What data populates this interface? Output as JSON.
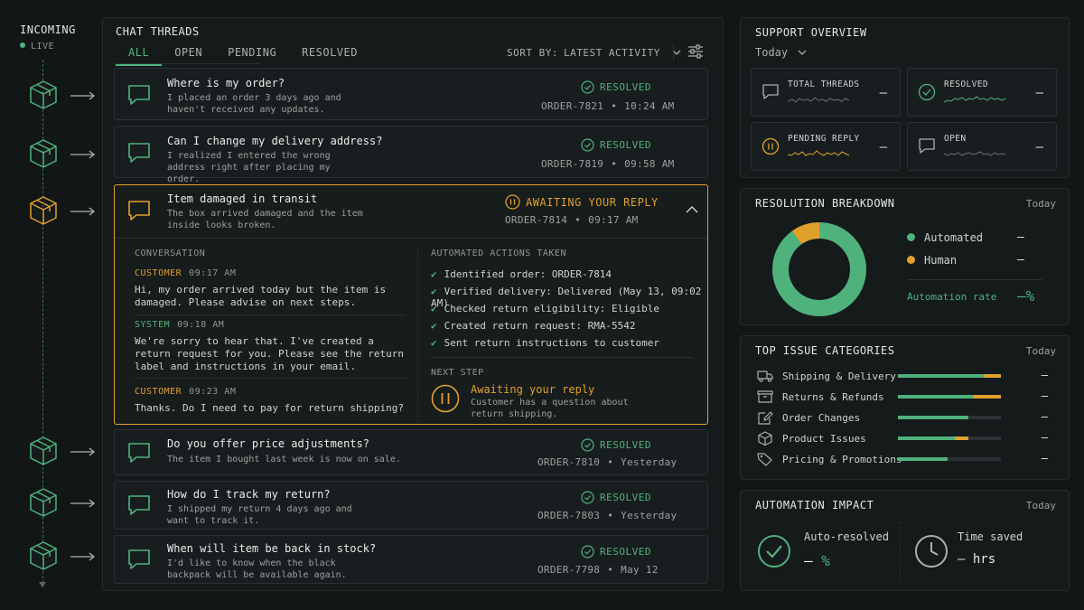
{
  "rail": {
    "title": "INCOMING",
    "live": "LIVE"
  },
  "threads": {
    "title": "CHAT THREADS",
    "tabs": [
      "ALL",
      "OPEN",
      "PENDING",
      "RESOLVED"
    ],
    "sort_label": "SORT BY:",
    "sort_value": "LATEST ACTIVITY",
    "items": [
      {
        "title": "Where is my order?",
        "desc": "I placed an order 3 days ago and haven't received any updates.",
        "status": "RESOLVED",
        "order": "ORDER-7821",
        "time": "10:24 AM"
      },
      {
        "title": "Can I change my delivery address?",
        "desc": "I realized I entered the wrong address right after placing my order.",
        "status": "RESOLVED",
        "order": "ORDER-7819",
        "time": "09:58 AM"
      },
      {
        "title": "Item damaged in transit",
        "desc": "The box arrived damaged and the item inside looks broken.",
        "status": "AWAITING YOUR REPLY",
        "order": "ORDER-7814",
        "time": "09:17 AM"
      },
      {
        "title": "Do you offer price adjustments?",
        "desc": "The item I bought last week is now on sale.",
        "status": "RESOLVED",
        "order": "ORDER-7810",
        "time": "Yesterday"
      },
      {
        "title": "How do I track my return?",
        "desc": "I shipped my return 4 days ago and want to track it.",
        "status": "RESOLVED",
        "order": "ORDER-7803",
        "time": "Yesterday"
      },
      {
        "title": "When will item be back in stock?",
        "desc": "I'd like to know when the black backpack will be available again.",
        "status": "RESOLVED",
        "order": "ORDER-7798",
        "time": "May 12"
      }
    ],
    "expanded": {
      "conversation_label": "CONVERSATION",
      "messages": [
        {
          "who": "CUSTOMER",
          "time": "09:17 AM",
          "text": "Hi, my order arrived today but the item is damaged. Please advise on next steps."
        },
        {
          "who": "SYSTEM",
          "time": "09:18 AM",
          "text": "We're sorry to hear that. I've created a return request for you. Please see the return label and instructions in your email."
        },
        {
          "who": "CUSTOMER",
          "time": "09:23 AM",
          "text": "Thanks. Do I need to pay for return shipping?"
        }
      ],
      "actions_label": "AUTOMATED ACTIONS TAKEN",
      "actions": [
        "Identified order: ORDER-7814",
        "Verified delivery: Delivered (May 13, 09:02 AM)",
        "Checked return eligibility: Eligible",
        "Created return request: RMA-5542",
        "Sent return instructions to customer"
      ],
      "next_step_label": "NEXT STEP",
      "next_step_title": "Awaiting your reply",
      "next_step_desc": "Customer has a question about return shipping."
    }
  },
  "overview": {
    "title": "SUPPORT OVERVIEW",
    "period": "Today",
    "stats": [
      {
        "label": "TOTAL THREADS",
        "value": "—",
        "icon": "chat-icon"
      },
      {
        "label": "RESOLVED",
        "value": "—",
        "icon": "check-circle-icon"
      },
      {
        "label": "PENDING REPLY",
        "value": "—",
        "icon": "pause-circle-icon"
      },
      {
        "label": "OPEN",
        "value": "—",
        "icon": "chat-icon"
      }
    ]
  },
  "breakdown": {
    "title": "RESOLUTION BREAKDOWN",
    "period": "Today",
    "legend": [
      {
        "label": "Automated",
        "value": "—",
        "color": "#4fb27d"
      },
      {
        "label": "Human",
        "value": "—",
        "color": "#e0a12c"
      }
    ],
    "rate_label": "Automation rate",
    "rate_value": "—%",
    "automated_fraction": 0.9
  },
  "issues": {
    "title": "TOP ISSUE CATEGORIES",
    "period": "Today",
    "items": [
      {
        "label": "Shipping & Delivery",
        "value": "—",
        "green": 0.83,
        "amber": 0.17,
        "icon": "truck-icon"
      },
      {
        "label": "Returns & Refunds",
        "value": "—",
        "green": 0.74,
        "amber": 0.26,
        "icon": "box-icon"
      },
      {
        "label": "Order Changes",
        "value": "—",
        "green": 0.68,
        "amber": 0.0,
        "icon": "edit-icon"
      },
      {
        "label": "Product Issues",
        "value": "—",
        "green": 0.55,
        "amber": 0.13,
        "icon": "package-icon"
      },
      {
        "label": "Pricing & Promotions",
        "value": "—",
        "green": 0.48,
        "amber": 0.0,
        "icon": "tag-icon"
      }
    ]
  },
  "impact": {
    "title": "AUTOMATION IMPACT",
    "period": "Today",
    "auto_label": "Auto-resolved",
    "auto_value": "—",
    "auto_unit": "%",
    "time_label": "Time saved",
    "time_value": "—",
    "time_unit": "hrs"
  }
}
